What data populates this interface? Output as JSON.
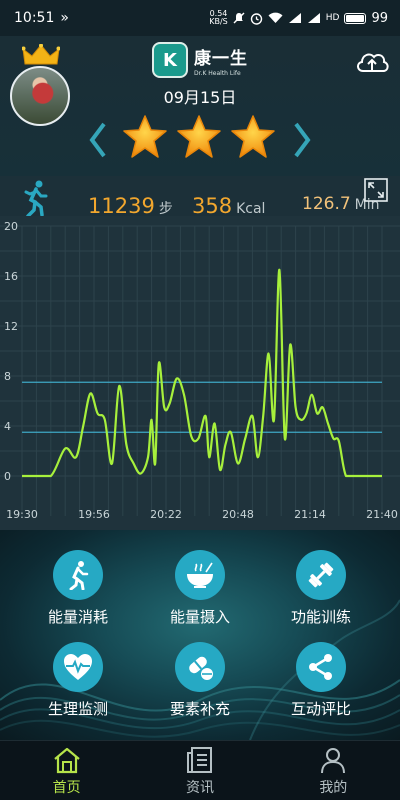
{
  "status_bar": {
    "time": "10:51",
    "speed_value": "0.54",
    "speed_unit": "KB/S",
    "battery": "99"
  },
  "header": {
    "brand_name": "康一生",
    "brand_sub": "Dr.K Health Life",
    "brand_logo_letter": "K",
    "date": "09月15日",
    "stars": 3
  },
  "stats": {
    "steps_value": "11239",
    "steps_unit": "步",
    "kcal_value": "358",
    "kcal_unit": "Kcal",
    "minutes_value": "126.7",
    "minutes_unit": "Min"
  },
  "chart_data": {
    "type": "line",
    "x_ticks": [
      "19:30",
      "19:56",
      "20:22",
      "20:48",
      "21:14",
      "21:40"
    ],
    "y_ticks": [
      "20",
      "16",
      "12",
      "8",
      "4",
      "0"
    ],
    "ylim": [
      0,
      20
    ],
    "reference_lines": [
      7.5,
      3.5
    ],
    "line_color": "#a7f03c",
    "series": [
      {
        "x": [
          0.0,
          0.03,
          0.08,
          0.12,
          0.15,
          0.17,
          0.19,
          0.21,
          0.23,
          0.25,
          0.27,
          0.29,
          0.31,
          0.33,
          0.35,
          0.36,
          0.37,
          0.38,
          0.395,
          0.41,
          0.43,
          0.45,
          0.47,
          0.49,
          0.51,
          0.52,
          0.535,
          0.55,
          0.565,
          0.58,
          0.6,
          0.62,
          0.64,
          0.655,
          0.67,
          0.685,
          0.7,
          0.715,
          0.73,
          0.745,
          0.76,
          0.775,
          0.79,
          0.805,
          0.82,
          0.835,
          0.85,
          0.865,
          0.88,
          0.9,
          0.93,
          0.96,
          1.0
        ],
        "y": [
          0,
          0,
          0,
          2.2,
          1.5,
          4,
          6.6,
          5,
          4.5,
          1,
          7.2,
          2.5,
          1,
          0.2,
          1.5,
          4.5,
          1,
          9,
          5.5,
          5.8,
          7.8,
          6.5,
          3.2,
          3,
          4.8,
          1.5,
          4.2,
          0.5,
          2.5,
          3.5,
          1,
          3,
          4.8,
          1.5,
          4.8,
          9.8,
          4.5,
          16.5,
          3,
          10.5,
          5.5,
          4.5,
          5,
          6.5,
          5,
          5.5,
          4.2,
          3,
          2.8,
          0,
          0,
          0,
          0
        ]
      }
    ]
  },
  "functions": [
    {
      "label": "能量消耗",
      "icon": "running-icon"
    },
    {
      "label": "能量摄入",
      "icon": "food-bowl-icon"
    },
    {
      "label": "功能训练",
      "icon": "dumbbell-icon"
    },
    {
      "label": "生理监测",
      "icon": "heartbeat-icon"
    },
    {
      "label": "要素补充",
      "icon": "pills-icon"
    },
    {
      "label": "互动评比",
      "icon": "share-icon"
    }
  ],
  "bottom_nav": {
    "home": "首页",
    "news": "资讯",
    "mine": "我的"
  },
  "colors": {
    "accent_green": "#b6e34a",
    "stat_orange": "#f2a72e",
    "function_blue": "#26a9c4"
  }
}
